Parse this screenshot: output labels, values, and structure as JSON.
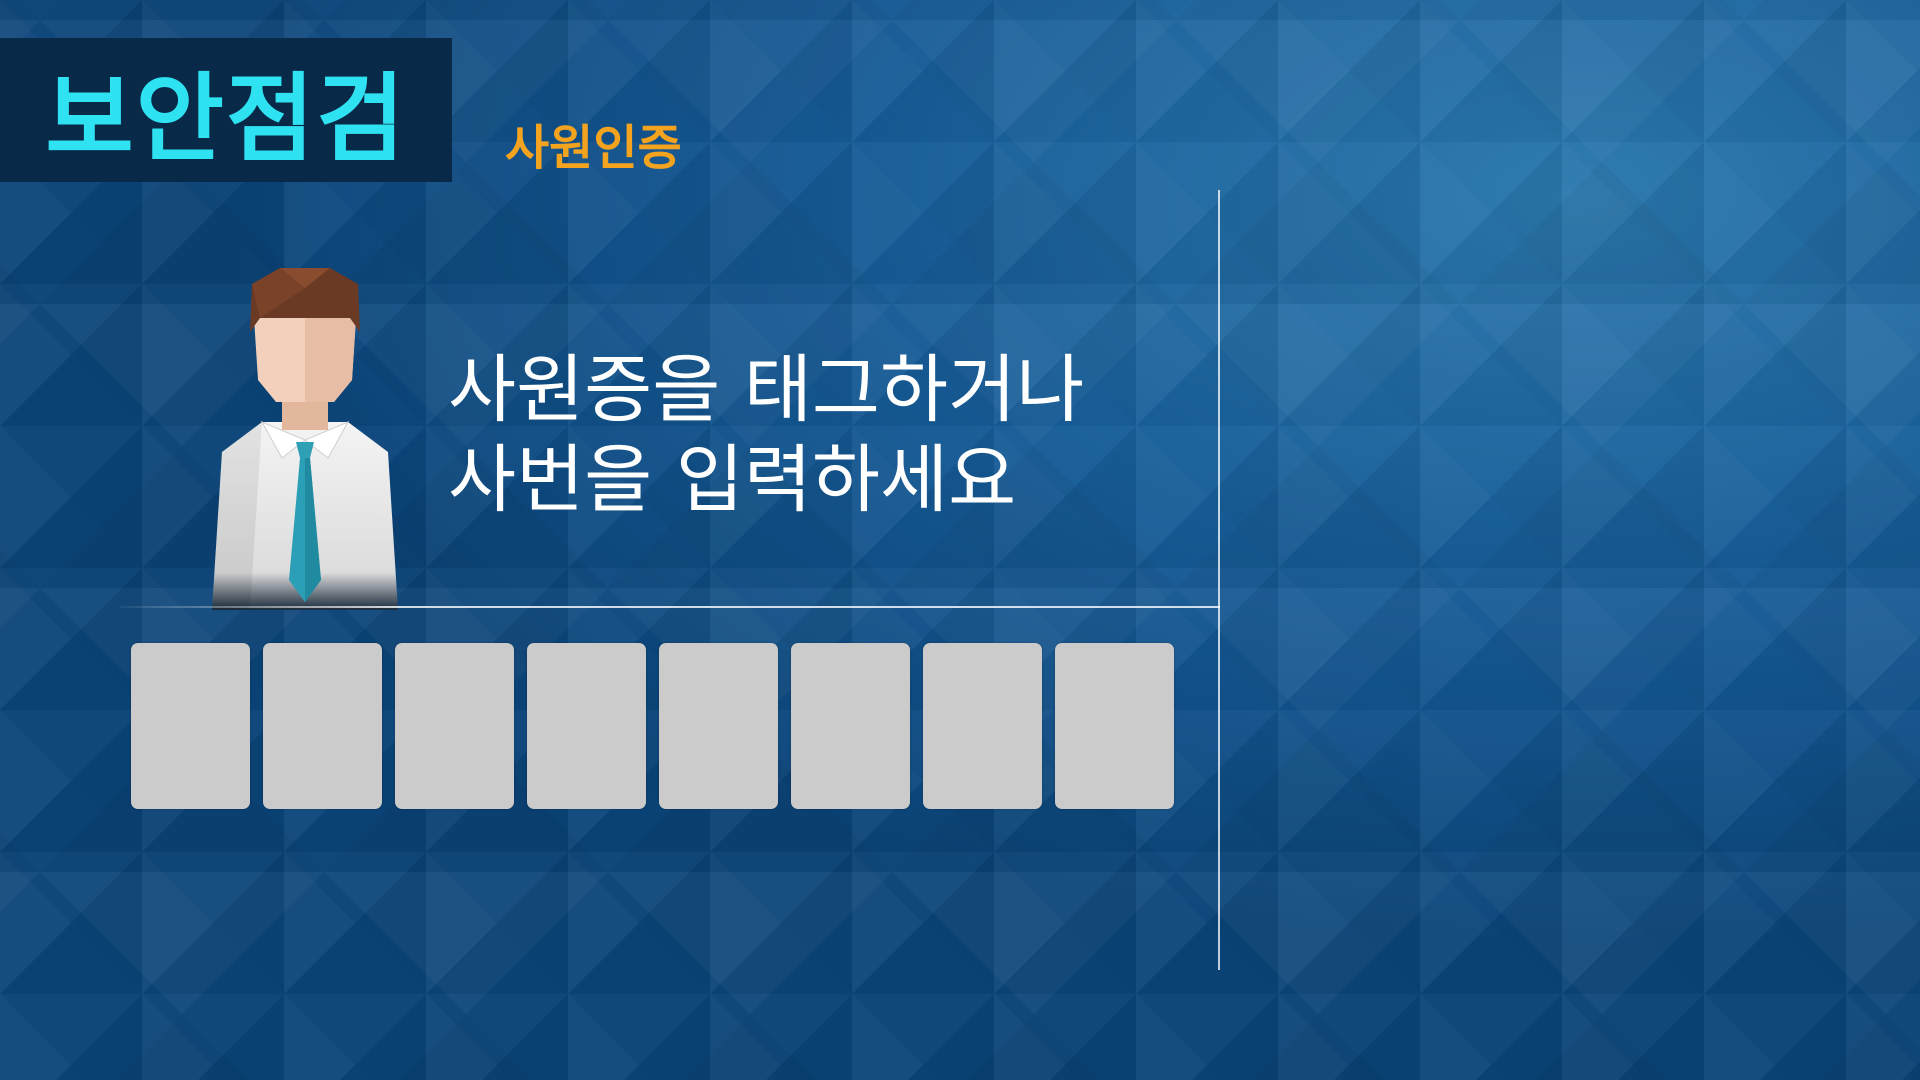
{
  "header": {
    "title": "보안점검",
    "subtitle": "사원인증"
  },
  "prompt": {
    "line1": "사원증을 태그하거나",
    "line2": "사번을 입력하세요"
  },
  "employee_id": {
    "digits": [
      "",
      "",
      "",
      "",
      "",
      "",
      "",
      ""
    ]
  },
  "colors": {
    "background": "#0f4f86",
    "title_bg": "#082948",
    "title_text": "#2fe2f2",
    "subtitle_text": "#f4a31f",
    "digit_box": "#cbcbcb",
    "tie": "#2a9fb5"
  },
  "icons": {
    "avatar": "employee-avatar-icon"
  }
}
